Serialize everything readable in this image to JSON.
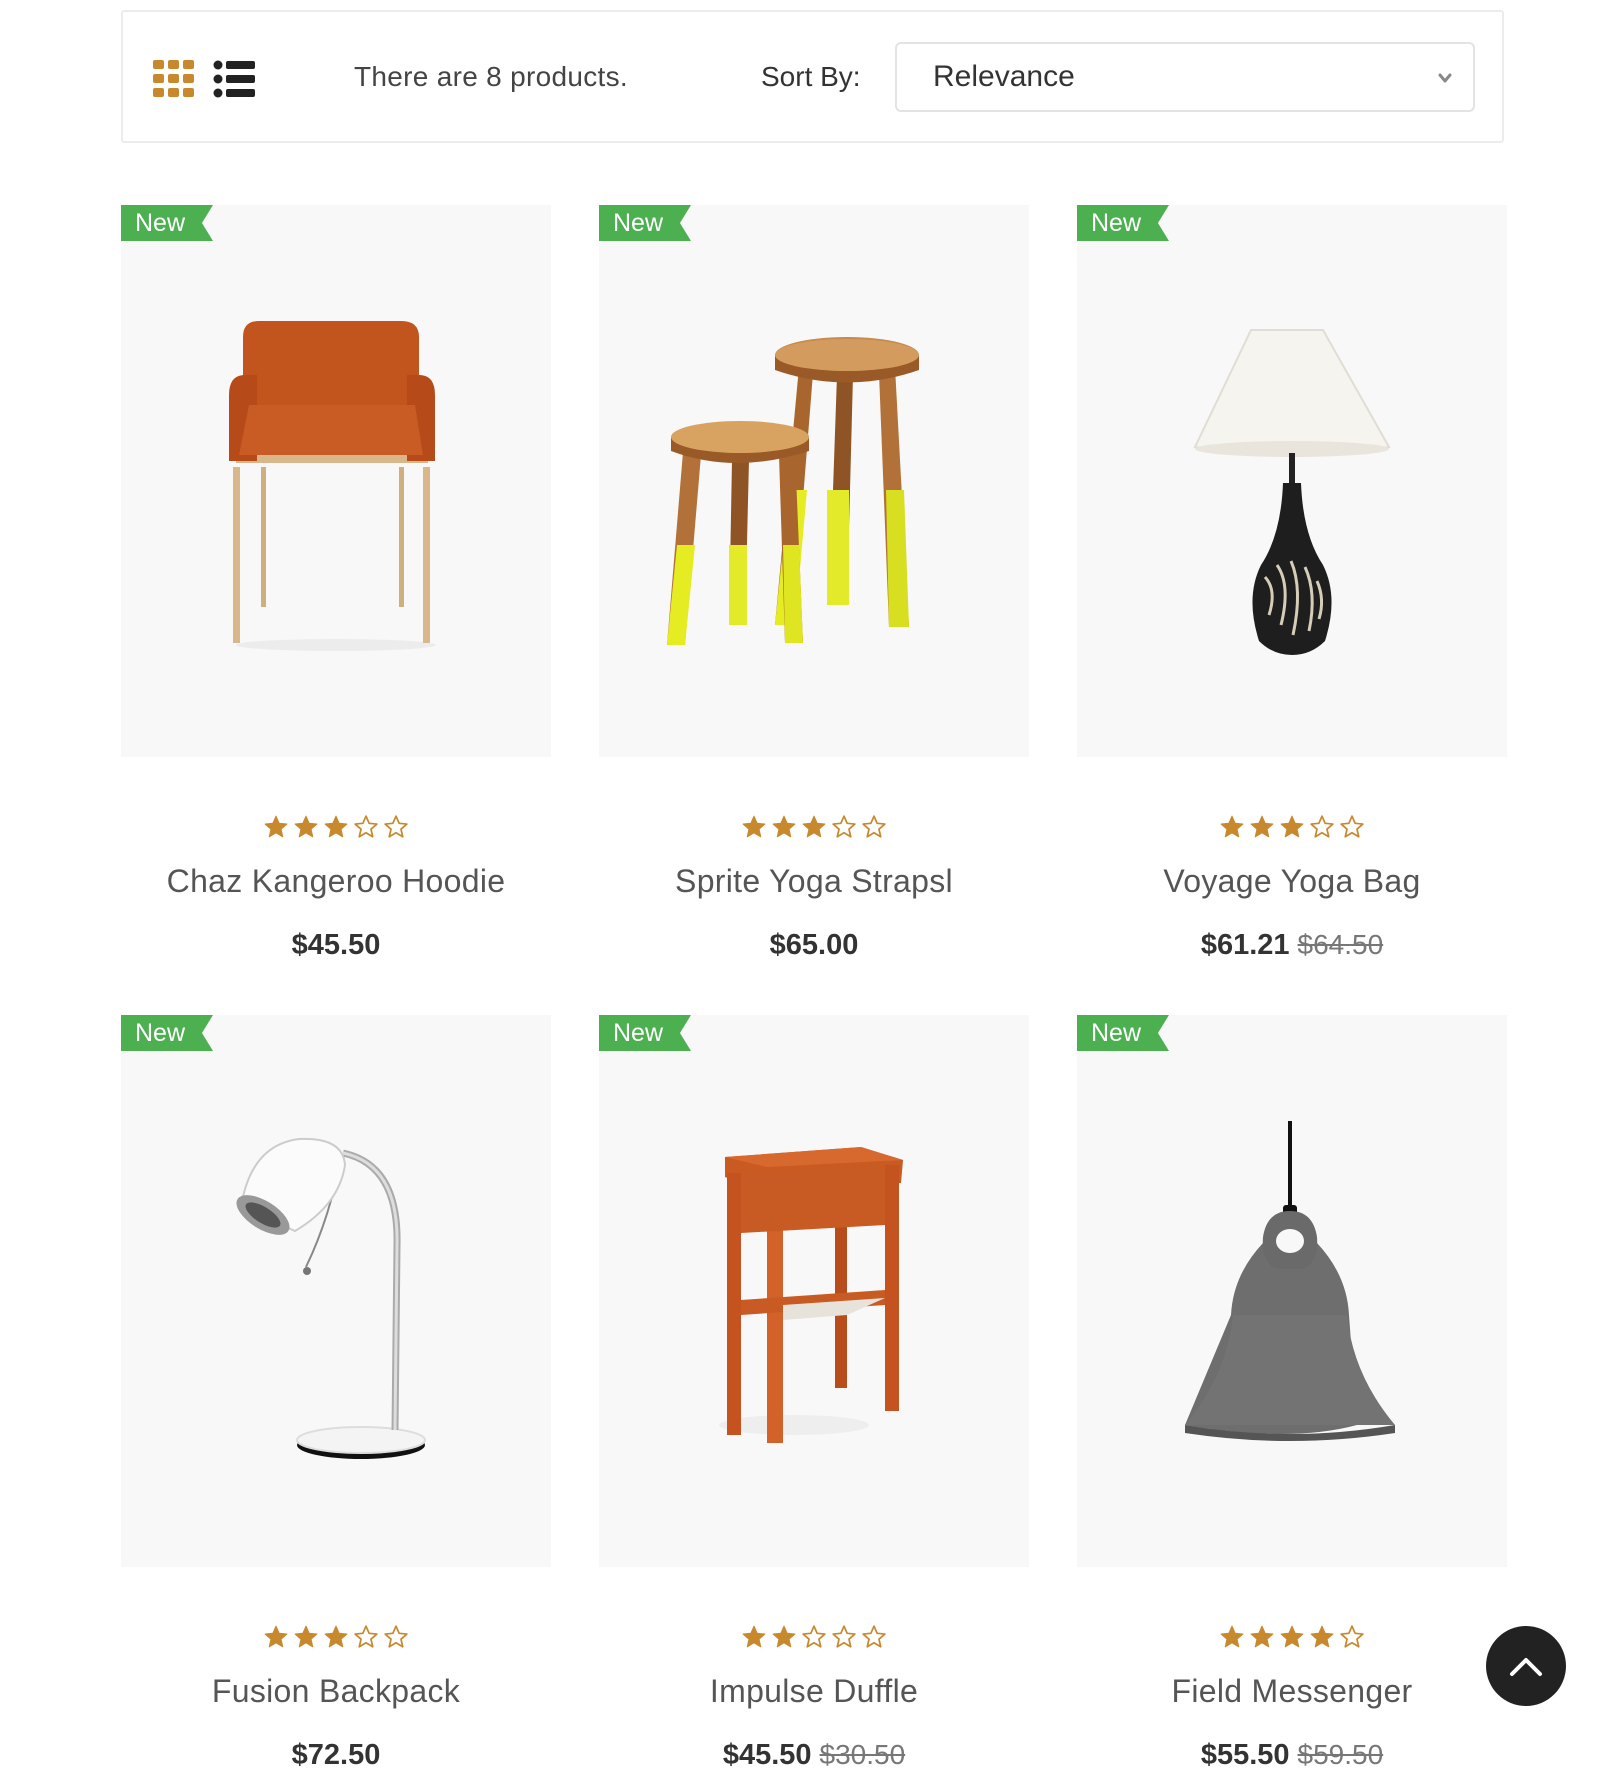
{
  "toolbar": {
    "grid_view_icon": "grid-icon",
    "list_view_icon": "list-icon",
    "product_count_text": "There are 8 products.",
    "sort_label": "Sort By:",
    "sort_value": "Relevance",
    "accent_color": "#c8892e"
  },
  "badge_color": "#4caf50",
  "star_color": "#c8892e",
  "products": [
    {
      "badge": "New",
      "title": "Chaz Kangeroo Hoodie",
      "price": "$45.50",
      "old_price": "",
      "rating": 3,
      "image": "armchair"
    },
    {
      "badge": "New",
      "title": "Sprite Yoga Strapsl",
      "price": "$65.00",
      "old_price": "",
      "rating": 3,
      "image": "stools"
    },
    {
      "badge": "New",
      "title": "Voyage Yoga Bag",
      "price": "$61.21",
      "old_price": "$64.50",
      "rating": 3,
      "image": "table-lamp"
    },
    {
      "badge": "New",
      "title": "Fusion Backpack",
      "price": "$72.50",
      "old_price": "",
      "rating": 3,
      "image": "desk-lamp"
    },
    {
      "badge": "New",
      "title": "Impulse Duffle",
      "price": "$45.50",
      "old_price": "$30.50",
      "rating": 2,
      "image": "side-table"
    },
    {
      "badge": "New",
      "title": "Field Messenger",
      "price": "$55.50",
      "old_price": "$59.50",
      "rating": 4,
      "image": "pendant-lamp"
    }
  ],
  "back_to_top_icon": "chevron-up-icon"
}
